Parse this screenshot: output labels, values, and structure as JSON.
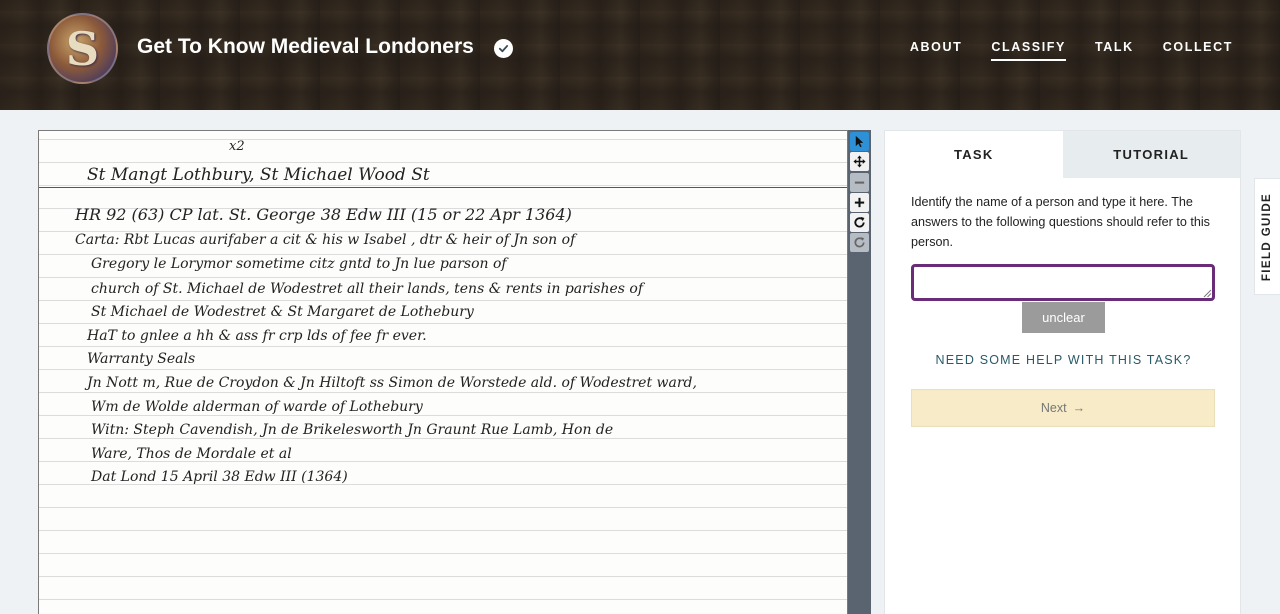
{
  "header": {
    "title": "Get To Know Medieval Londoners",
    "avatar_letter": "S",
    "nav": [
      {
        "label": "ABOUT",
        "active": false
      },
      {
        "label": "CLASSIFY",
        "active": true
      },
      {
        "label": "TALK",
        "active": false
      },
      {
        "label": "COLLECT",
        "active": false
      }
    ]
  },
  "subject": {
    "lines": [
      "x2",
      "St Mangt Lothbury,   St Michael Wood St",
      "HR 92  (63)           CP lat. St. George          38 Edw III   (15 or 22 Apr 1364)",
      "Carta:     Rbt  Lucas   aurifaber  a cit   &  his  w  Isabel ,  dtr & heir  of  Jn  son  of",
      "Gregory  le  Lorymor   sometime  citz     gntd  to   Jn   lue    parson  of",
      "church  of    St.  Michael  de  Wodestret     all  their  lands,  tens  &  rents  in  parishes  of",
      "St Michael  de  Wodestret   &  St Margaret  de  Lothebury",
      "HaT  to   gnlee a  hh  & ass   fr crp   lds  of   fee    fr  ever.",
      "Warranty      Seals",
      "Jn  Nott   m,   Rue de  Croydon  &  Jn  Hiltoft   ss    Simon de  Worstede  ald. of Wodestret ward,",
      "Wm de Wolde   alderman of  warde of   Lothebury",
      "Witn:  Steph   Cavendish,  Jn de  Brikelesworth    Jn  Graunt    Rue Lamb,  Hon de",
      "Ware,      Thos   de     Mordale    et al",
      "Dat  Lond        15 April    38 Edw III      (1364)"
    ]
  },
  "toolbar": {
    "tools": [
      {
        "name": "pointer-tool",
        "icon": "cursor-arrow-icon",
        "state": "selected"
      },
      {
        "name": "move-tool",
        "icon": "move-arrows-icon",
        "state": "normal"
      },
      {
        "name": "zoom-out-tool",
        "icon": "minus-icon",
        "state": "disabled"
      },
      {
        "name": "zoom-in-tool",
        "icon": "plus-icon",
        "state": "normal"
      },
      {
        "name": "rotate-tool",
        "icon": "rotate-icon",
        "state": "normal"
      },
      {
        "name": "reset-tool",
        "icon": "reset-icon",
        "state": "disabled"
      }
    ]
  },
  "task": {
    "tabs": [
      {
        "label": "TASK",
        "active": true
      },
      {
        "label": "TUTORIAL",
        "active": false
      }
    ],
    "instructions": "Identify the name of a person and type it here. The answers to the following questions should refer to this person.",
    "answer_value": "",
    "unclear_label": "unclear",
    "help_label": "NEED SOME HELP WITH THIS TASK?",
    "next_label": "Next",
    "next_arrow": "→"
  },
  "field_guide": {
    "label": "FIELD GUIDE"
  },
  "colors": {
    "accent_purple": "#6a2c78",
    "help_teal": "#285a68",
    "next_bg": "#f7ecc7",
    "toolbar_bg": "#5a6470",
    "selected_tool": "#2e90d6"
  }
}
